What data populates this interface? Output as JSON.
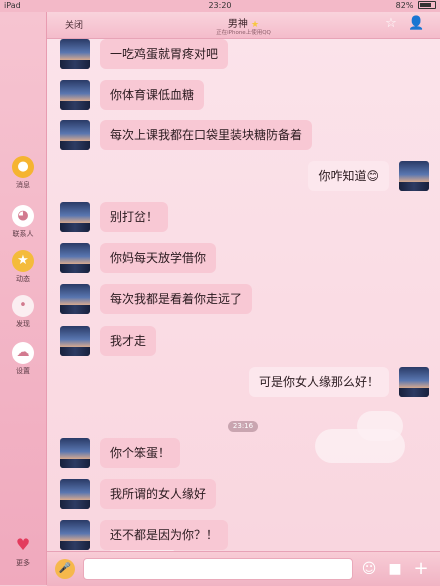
{
  "status_bar": {
    "device": "iPad",
    "time": "23:20",
    "battery": "82%"
  },
  "sidebar": {
    "items": [
      {
        "label": "消息",
        "icon": "duck-message-icon"
      },
      {
        "label": "联系人",
        "icon": "cat-contacts-icon"
      },
      {
        "label": "动态",
        "icon": "duck-feed-icon"
      },
      {
        "label": "发现",
        "icon": "bunny-discover-icon"
      },
      {
        "label": "设置",
        "icon": "cloud-settings-icon"
      },
      {
        "label": "更多",
        "icon": "heart-more-icon"
      }
    ]
  },
  "header": {
    "close_label": "关闭",
    "title": "男神",
    "subtitle": "正在iPhone上使用QQ"
  },
  "messages": [
    {
      "side": "in",
      "text": "一吃鸡蛋就胃疼对吧"
    },
    {
      "side": "in",
      "text": "你体育课低血糖"
    },
    {
      "side": "in",
      "text": "每次上课我都在口袋里装块糖防备着"
    },
    {
      "side": "out",
      "text": "你咋知道😊"
    },
    {
      "side": "in",
      "text": "别打岔！"
    },
    {
      "side": "in",
      "text": "你妈每天放学借你"
    },
    {
      "side": "in",
      "text": "每次我都是看着你走远了"
    },
    {
      "side": "in",
      "text": "我才走"
    },
    {
      "side": "out",
      "text": "可是你女人缘那么好！"
    },
    {
      "side": "in",
      "text": "你个笨蛋！"
    },
    {
      "side": "in",
      "text": "我所谓的女人缘好"
    },
    {
      "side": "in",
      "text": "还不都是因为你？！"
    }
  ],
  "timestamp": "23:16",
  "input": {
    "placeholder": ""
  }
}
